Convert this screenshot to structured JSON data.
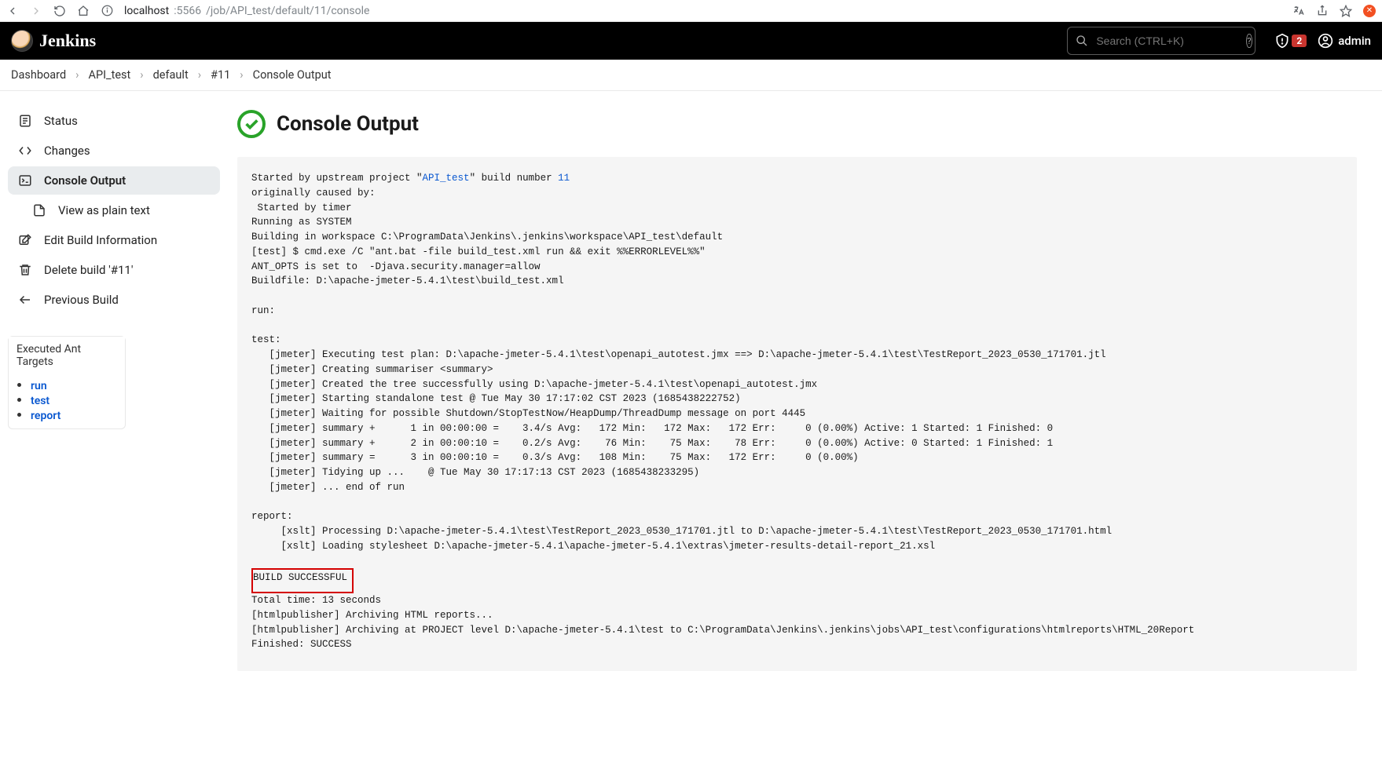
{
  "browser": {
    "url_host": "localhost",
    "url_port": ":5566",
    "url_path": "/job/API_test/default/11/console"
  },
  "header": {
    "brand": "Jenkins",
    "search_placeholder": "Search (CTRL+K)",
    "alert_count": "2",
    "user_name": "admin"
  },
  "breadcrumbs": {
    "items": [
      "Dashboard",
      "API_test",
      "default",
      "#11",
      "Console Output"
    ]
  },
  "sidebar": {
    "items": [
      {
        "label": "Status"
      },
      {
        "label": "Changes"
      },
      {
        "label": "Console Output"
      },
      {
        "label": "View as plain text"
      },
      {
        "label": "Edit Build Information"
      },
      {
        "label": "Delete build '#11'"
      },
      {
        "label": "Previous Build"
      }
    ],
    "section_title": "Executed Ant Targets",
    "section_links": [
      "run",
      "test",
      "report"
    ]
  },
  "main": {
    "title": "Console Output"
  },
  "console": {
    "l1a": "Started by upstream project \"",
    "l1_link": "API_test",
    "l1b": "\" build number ",
    "l1_num": "11",
    "l2": "originally caused by:",
    "l3": " Started by timer",
    "l4": "Running as SYSTEM",
    "l5": "Building in workspace C:\\ProgramData\\Jenkins\\.jenkins\\workspace\\API_test\\default",
    "l6": "[test] $ cmd.exe /C \"ant.bat -file build_test.xml run && exit %%ERRORLEVEL%%\"",
    "l7": "ANT_OPTS is set to  -Djava.security.manager=allow",
    "l8": "Buildfile: D:\\apache-jmeter-5.4.1\\test\\build_test.xml",
    "run_hdr": "run:",
    "test_hdr": "test:",
    "t1": "   [jmeter] Executing test plan: D:\\apache-jmeter-5.4.1\\test\\openapi_autotest.jmx ==> D:\\apache-jmeter-5.4.1\\test\\TestReport_2023_0530_171701.jtl",
    "t2": "   [jmeter] Creating summariser <summary>",
    "t3": "   [jmeter] Created the tree successfully using D:\\apache-jmeter-5.4.1\\test\\openapi_autotest.jmx",
    "t4": "   [jmeter] Starting standalone test @ Tue May 30 17:17:02 CST 2023 (1685438222752)",
    "t5": "   [jmeter] Waiting for possible Shutdown/StopTestNow/HeapDump/ThreadDump message on port 4445",
    "t6": "   [jmeter] summary +      1 in 00:00:00 =    3.4/s Avg:   172 Min:   172 Max:   172 Err:     0 (0.00%) Active: 1 Started: 1 Finished: 0",
    "t7": "   [jmeter] summary +      2 in 00:00:10 =    0.2/s Avg:    76 Min:    75 Max:    78 Err:     0 (0.00%) Active: 0 Started: 1 Finished: 1",
    "t8": "   [jmeter] summary =      3 in 00:00:10 =    0.3/s Avg:   108 Min:    75 Max:   172 Err:     0 (0.00%)",
    "t9": "   [jmeter] Tidying up ...    @ Tue May 30 17:17:13 CST 2023 (1685438233295)",
    "t10": "   [jmeter] ... end of run",
    "report_hdr": "report:",
    "r1": "     [xslt] Processing D:\\apache-jmeter-5.4.1\\test\\TestReport_2023_0530_171701.jtl to D:\\apache-jmeter-5.4.1\\test\\TestReport_2023_0530_171701.html",
    "r2": "     [xslt] Loading stylesheet D:\\apache-jmeter-5.4.1\\apache-jmeter-5.4.1\\extras\\jmeter-results-detail-report_21.xsl",
    "build_success": "BUILD SUCCESSFUL",
    "total_time": "Total time: 13 seconds",
    "ar1": "[htmlpublisher] Archiving HTML reports...",
    "ar2": "[htmlpublisher] Archiving at PROJECT level D:\\apache-jmeter-5.4.1\\test to C:\\ProgramData\\Jenkins\\.jenkins\\jobs\\API_test\\configurations\\htmlreports\\HTML_20Report",
    "finished": "Finished: SUCCESS"
  }
}
